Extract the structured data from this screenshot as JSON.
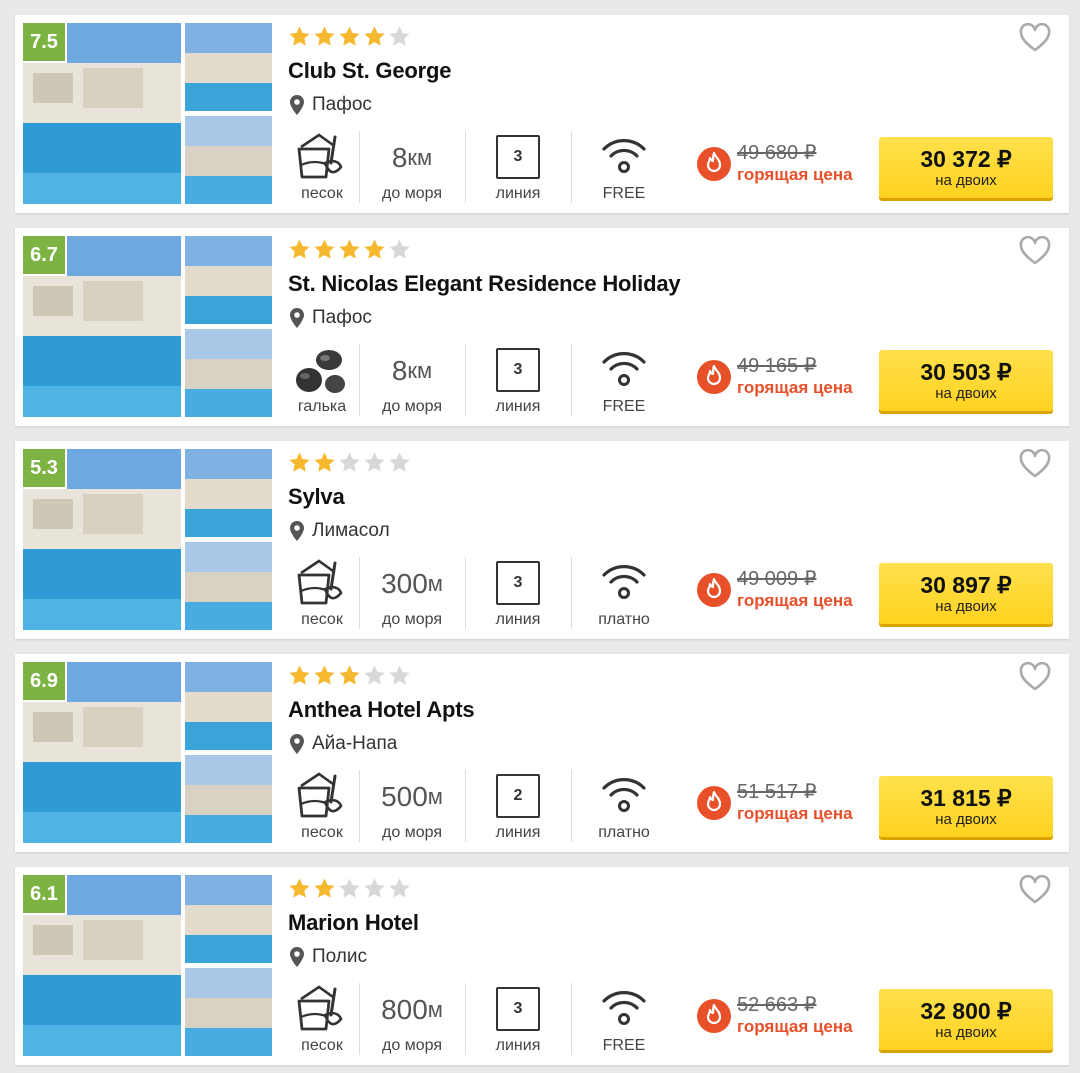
{
  "currency_symbol": "₽",
  "labels": {
    "distance_caption": "до моря",
    "line_caption": "линия",
    "hot_price": "горящая цена",
    "per_two": "на двоих"
  },
  "colors": {
    "rating_badge": "#7cb342",
    "star_filled": "#f5b82e",
    "star_empty": "#d8d8d8",
    "hot": "#e8502a",
    "price_button": "#ffd21f"
  },
  "hotels": [
    {
      "rating": "7.5",
      "stars": 4,
      "name": "Club St. George",
      "location": "Пафос",
      "beach": "песок",
      "beach_icon": "sand-bucket-icon",
      "distance_num": "8",
      "distance_unit": "км",
      "line": "3",
      "wifi": "FREE",
      "old_price": "49 680 ₽",
      "price": "30 372 ₽"
    },
    {
      "rating": "6.7",
      "stars": 4,
      "name": "St. Nicolas Elegant Residence Holiday",
      "location": "Пафос",
      "beach": "галька",
      "beach_icon": "pebbles-icon",
      "distance_num": "8",
      "distance_unit": "км",
      "line": "3",
      "wifi": "FREE",
      "old_price": "49 165 ₽",
      "price": "30 503 ₽"
    },
    {
      "rating": "5.3",
      "stars": 2,
      "name": "Sylva",
      "location": "Лимасол",
      "beach": "песок",
      "beach_icon": "sand-bucket-icon",
      "distance_num": "300",
      "distance_unit": "м",
      "line": "3",
      "wifi": "платно",
      "old_price": "49 009 ₽",
      "price": "30 897 ₽"
    },
    {
      "rating": "6.9",
      "stars": 3,
      "name": "Anthea Hotel Apts",
      "location": "Айа-Напа",
      "beach": "песок",
      "beach_icon": "sand-bucket-icon",
      "distance_num": "500",
      "distance_unit": "м",
      "line": "2",
      "wifi": "платно",
      "old_price": "51 517 ₽",
      "price": "31 815 ₽"
    },
    {
      "rating": "6.1",
      "stars": 2,
      "name": "Marion Hotel",
      "location": "Полис",
      "beach": "песок",
      "beach_icon": "sand-bucket-icon",
      "distance_num": "800",
      "distance_unit": "м",
      "line": "3",
      "wifi": "FREE",
      "old_price": "52 663 ₽",
      "price": "32 800 ₽"
    }
  ]
}
